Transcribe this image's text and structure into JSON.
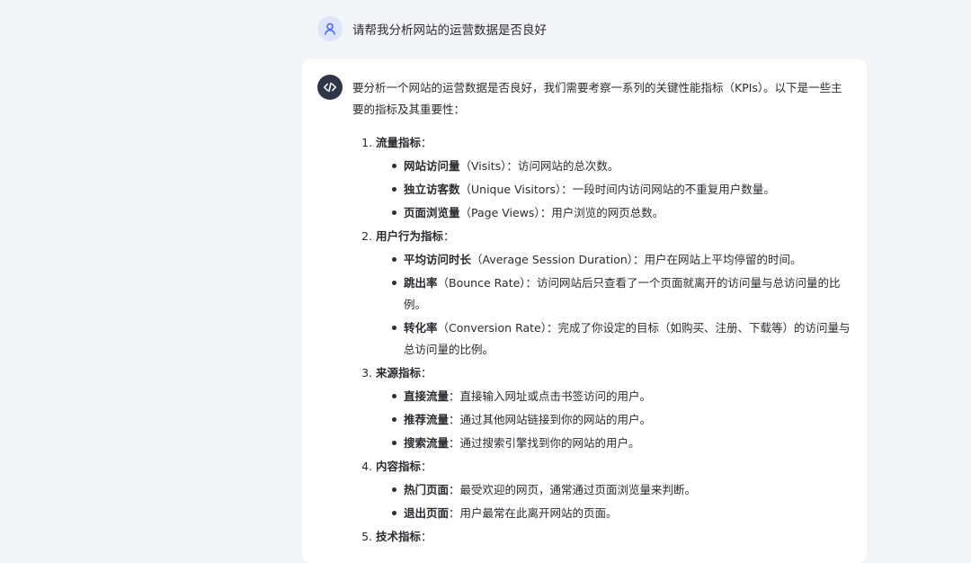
{
  "user": {
    "avatar_icon": "user-icon",
    "question": "请帮我分析网站的运营数据是否良好"
  },
  "answer": {
    "avatar_icon": "code-icon",
    "intro": "要分析一个网站的运营数据是否良好，我们需要考察一系列的关键性能指标（KPIs）。以下是一些主要的指标及其重要性：",
    "sections": [
      {
        "title": "流量指标",
        "items": [
          {
            "name": "网站访问量",
            "en": "（Visits）",
            "desc": "：访问网站的总次数。"
          },
          {
            "name": "独立访客数",
            "en": "（Unique Visitors）",
            "desc": "：一段时间内访问网站的不重复用户数量。"
          },
          {
            "name": "页面浏览量",
            "en": "（Page Views）",
            "desc": "：用户浏览的网页总数。"
          }
        ]
      },
      {
        "title": "用户行为指标",
        "items": [
          {
            "name": "平均访问时长",
            "en": "（Average Session Duration）",
            "desc": "：用户在网站上平均停留的时间。"
          },
          {
            "name": "跳出率",
            "en": "（Bounce Rate）",
            "desc": "：访问网站后只查看了一个页面就离开的访问量与总访问量的比例。"
          },
          {
            "name": "转化率",
            "en": "（Conversion Rate）",
            "desc": "：完成了你设定的目标（如购买、注册、下载等）的访问量与总访问量的比例。"
          }
        ]
      },
      {
        "title": "来源指标",
        "items": [
          {
            "name": "直接流量",
            "en": "",
            "desc": "：直接输入网址或点击书签访问的用户。"
          },
          {
            "name": "推荐流量",
            "en": "",
            "desc": "：通过其他网站链接到你的网站的用户。"
          },
          {
            "name": "搜索流量",
            "en": "",
            "desc": "：通过搜索引擎找到你的网站的用户。"
          }
        ]
      },
      {
        "title": "内容指标",
        "items": [
          {
            "name": "热门页面",
            "en": "",
            "desc": "：最受欢迎的网页，通常通过页面浏览量来判断。"
          },
          {
            "name": "退出页面",
            "en": "",
            "desc": "：用户最常在此离开网站的页面。"
          }
        ]
      },
      {
        "title": "技术指标",
        "items": []
      }
    ]
  },
  "colors": {
    "background": "#f4f5f8",
    "card": "#ffffff",
    "user_avatar_bg": "#dde4fb",
    "user_avatar_fg": "#4a6cf7",
    "bot_avatar_bg": "#2e3648",
    "text": "#2b2b30"
  }
}
